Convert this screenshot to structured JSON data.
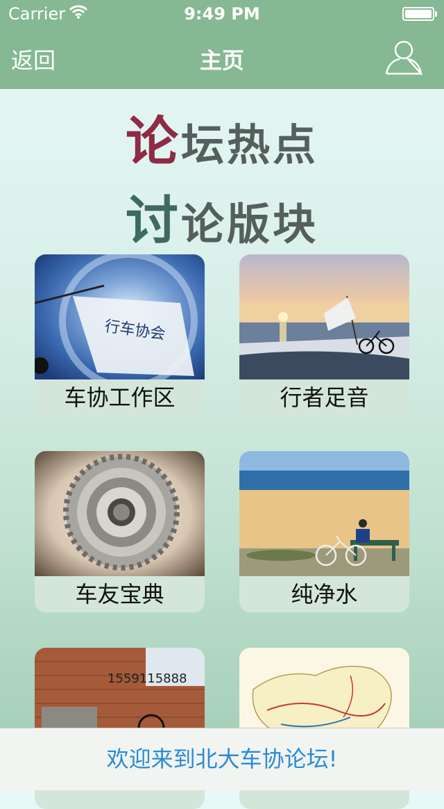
{
  "status_bar": {
    "carrier": "Carrier",
    "time": "9:49 PM"
  },
  "nav": {
    "back_label": "返回",
    "title": "主页",
    "user_icon": "person-icon"
  },
  "headings": {
    "hot": {
      "first": "论",
      "rest": "坛热点"
    },
    "board": {
      "first": "讨",
      "rest": "论版块"
    }
  },
  "sections": [
    {
      "label": "车协工作区"
    },
    {
      "label": "行者足音"
    },
    {
      "label": "车友宝典"
    },
    {
      "label": "纯净水"
    },
    {
      "label": ""
    },
    {
      "label": ""
    }
  ],
  "photo_text": {
    "flag_text": "行车协会",
    "phone_graffiti": "1559115888"
  },
  "footer": {
    "text": "欢迎来到北大车协论坛!"
  },
  "colors": {
    "nav_bar": "#86b893",
    "hot_accent": "#8e2b45",
    "board_accent": "#3f6963",
    "footer_text": "#2b8bd6"
  }
}
